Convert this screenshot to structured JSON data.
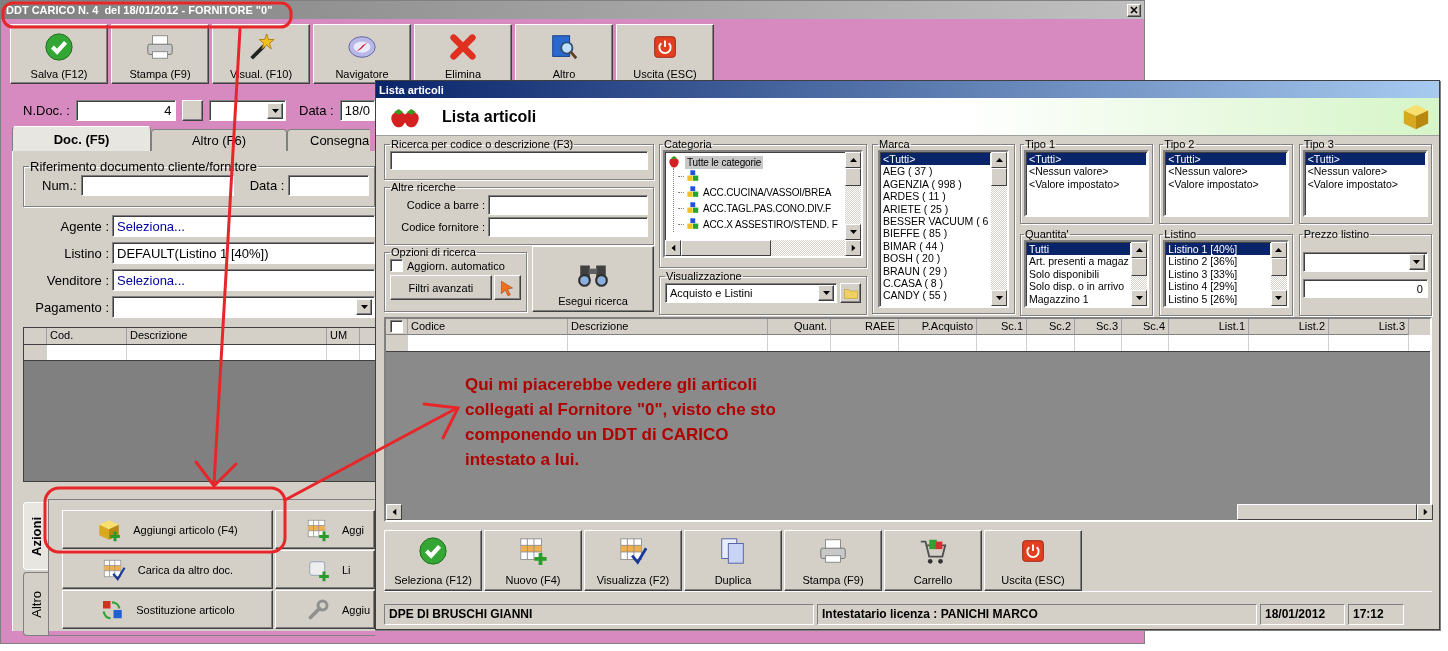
{
  "back_window": {
    "title": "DDT CARICO N. 4  del 18/01/2012 - FORNITORE \"0\"",
    "toolbar": [
      "Salva (F12)",
      "Stampa (F9)",
      "Visual. (F10)",
      "Navigatore",
      "Elimina",
      "Altro",
      "Uscita (ESC)"
    ],
    "doc_number": {
      "label": "N.Doc. :",
      "value": "4"
    },
    "date": {
      "label": "Data :",
      "value": "18/0"
    },
    "tabs": [
      {
        "label": "Doc. (F5)",
        "selected": true
      },
      {
        "label": "Altro (F6)",
        "selected": false
      },
      {
        "label": "Consegna",
        "selected": false
      }
    ],
    "reference_group": {
      "title": "Riferimento documento cliente/fornitore",
      "number_label": "Num.:",
      "date_label": "Data :"
    },
    "fields": [
      {
        "label": "Agente :",
        "value": "Seleziona...",
        "kind": "link"
      },
      {
        "label": "Listino :",
        "value": "DEFAULT(Listino 1 [40%])",
        "kind": "text"
      },
      {
        "label": "Venditore :",
        "value": "Seleziona...",
        "kind": "link"
      },
      {
        "label": "Pagamento :",
        "kind": "dropdown"
      }
    ],
    "grid_columns": [
      "Cod.",
      "Descrizione",
      "UM"
    ],
    "side_tabs": [
      {
        "label": "Azioni",
        "selected": true
      },
      {
        "label": "Altro",
        "selected": false
      }
    ],
    "actions": [
      [
        "Aggiungi articolo (F4)",
        "Aggi"
      ],
      [
        "Carica da altro doc.",
        "Li"
      ],
      [
        "Sostituzione articolo",
        "Aggiu"
      ]
    ]
  },
  "list_window": {
    "title": "Lista articoli",
    "heading": "Lista articoli",
    "search": {
      "title": "Ricerca per codice o descrizione (F3)"
    },
    "other_search": {
      "title": "Altre ricerche",
      "fields": [
        "Codice a barre :",
        "Codice fornitore :"
      ]
    },
    "options": {
      "title": "Opzioni di ricerca",
      "auto_update": {
        "label": "Aggiorn. automatico",
        "checked": false
      },
      "advanced_button": "Filtri avanzati"
    },
    "search_button": "Esegui ricerca",
    "category": {
      "title": "Categoria",
      "root": {
        "label": "Tutte le categorie",
        "selected": true,
        "children": [
          {
            "kind": "unnamed"
          },
          {
            "kind": "category",
            "label": "ACC.CUCINA/VASSOI/BREA"
          },
          {
            "kind": "category",
            "label": "ACC.TAGL.PAS.CONO.DIV.F"
          },
          {
            "kind": "category",
            "label": "ACC.X ASSESTIRO/STEND. F"
          }
        ]
      }
    },
    "view": {
      "title": "Visualizzazione",
      "value": "Acquisto e Listini"
    },
    "brand": {
      "title": "Marca",
      "items": [
        {
          "label": "<Tutti>",
          "selected": true
        },
        {
          "label": "AEG ( 37 )",
          "selected": false
        },
        {
          "label": "AGENZIA ( 998 )",
          "selected": false
        },
        {
          "label": "ARDES ( 11 )",
          "selected": false
        },
        {
          "label": "ARIETE ( 25 )",
          "selected": false
        },
        {
          "label": "BESSER VACUUM ( 6",
          "selected": false
        },
        {
          "label": "BIEFFE ( 85 )",
          "selected": false
        },
        {
          "label": "BIMAR ( 44 )",
          "selected": false
        },
        {
          "label": "BOSH ( 20 )",
          "selected": false
        },
        {
          "label": "BRAUN ( 29 )",
          "selected": false
        },
        {
          "label": "C.CASA ( 8 )",
          "selected": false
        },
        {
          "label": "CANDY ( 55 )",
          "selected": false
        }
      ]
    },
    "types": [
      {
        "title": "Tipo 1",
        "items": [
          {
            "label": "<Tutti>",
            "selected": true
          },
          {
            "label": "<Nessun valore>",
            "selected": false
          },
          {
            "label": "<Valore impostato>",
            "selected": false
          }
        ]
      },
      {
        "title": "Tipo 2",
        "items": [
          {
            "label": "<Tutti>",
            "selected": true
          },
          {
            "label": "<Nessun valore>",
            "selected": false
          },
          {
            "label": "<Valore impostato>",
            "selected": false
          }
        ]
      },
      {
        "title": "Tipo 3",
        "items": [
          {
            "label": "<Tutti>",
            "selected": true
          },
          {
            "label": "<Nessun valore>",
            "selected": false
          },
          {
            "label": "<Valore impostato>",
            "selected": false
          }
        ]
      }
    ],
    "quantity": {
      "title": "Quantita'",
      "items": [
        {
          "label": "Tutti",
          "selected": true
        },
        {
          "label": "Art. presenti a magaz",
          "selected": false
        },
        {
          "label": "Solo disponibili",
          "selected": false
        },
        {
          "label": "Solo disp. o in arrivo",
          "selected": false
        },
        {
          "label": "Magazzino 1",
          "selected": false
        }
      ]
    },
    "price_lists": {
      "title": "Listino",
      "items": [
        {
          "label": "Listino 1 [40%]",
          "selected": true
        },
        {
          "label": "Listino 2 [36%]",
          "selected": false
        },
        {
          "label": "Listino 3 [33%]",
          "selected": false
        },
        {
          "label": "Listino 4 [29%]",
          "selected": false
        },
        {
          "label": "Listino 5 [26%]",
          "selected": false
        }
      ]
    },
    "list_price": {
      "title": "Prezzo listino",
      "value": "0"
    },
    "table": {
      "select_all": {
        "checked": false
      },
      "columns": [
        "Codice",
        "Descrizione",
        "Quant.",
        "RAEE",
        "P.Acquisto",
        "Sc.1",
        "Sc.2",
        "Sc.3",
        "Sc.4",
        "List.1",
        "List.2",
        "List.3"
      ]
    },
    "buttons": [
      "Seleziona (F12)",
      "Nuovo (F4)",
      "Visualizza (F2)",
      "Duplica",
      "Stampa (F9)",
      "Carrello",
      "Uscita (ESC)"
    ],
    "status_bar": [
      "DPE DI BRUSCHI GIANNI",
      "Intestatario licenza : PANICHI MARCO",
      "18/01/2012",
      "17:12"
    ]
  },
  "annotation": {
    "lines": [
      "Qui mi piacerebbe vedere gli articoli",
      "collegati al Fornitore \"0\", visto che sto",
      "componendo un DDT di CARICO",
      "intestato a lui."
    ]
  }
}
